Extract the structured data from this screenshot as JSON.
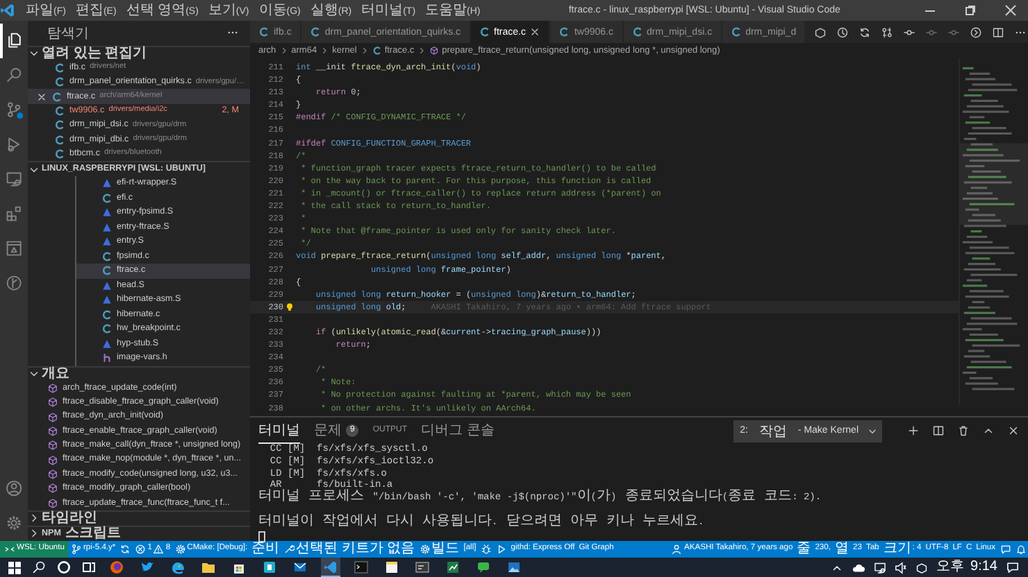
{
  "window": {
    "title": "ftrace.c - linux_raspberrypi [WSL: Ubuntu] - Visual Studio Code",
    "menu": [
      "파일(F)",
      "편집(E)",
      "선택 영역(S)",
      "보기(V)",
      "이동(G)",
      "실행(R)",
      "터미널(T)",
      "도움말(H)"
    ]
  },
  "activity_bar": [
    {
      "kind": "files",
      "selected": true,
      "badge": false
    },
    {
      "kind": "search",
      "selected": false,
      "badge": false
    },
    {
      "kind": "branch",
      "selected": false,
      "badge": true
    },
    {
      "kind": "run",
      "selected": false,
      "badge": false
    },
    {
      "kind": "monitor",
      "selected": false,
      "badge": false
    },
    {
      "kind": "blocks",
      "selected": false,
      "badge": false
    },
    {
      "kind": "panel",
      "selected": false,
      "badge": false
    },
    {
      "kind": "graph",
      "selected": false,
      "badge": false
    },
    {
      "kind": "account",
      "selected": false,
      "badge": false
    },
    {
      "kind": "gear",
      "selected": false,
      "badge": false
    }
  ],
  "sidebar": {
    "title": "탐색기",
    "open_editors": {
      "title": "열려 있는 편집기",
      "expanded": true,
      "items": [
        {
          "name": "ifb.c",
          "path": "drivers/net",
          "kind": "c",
          "selected": false,
          "error": false
        },
        {
          "name": "drm_panel_orientation_quirks.c",
          "path": "drivers/gpu/…",
          "kind": "c",
          "selected": false,
          "error": false
        },
        {
          "name": "ftrace.c",
          "path": "arch/arm64/kernel",
          "kind": "c",
          "selected": true,
          "error": false
        },
        {
          "name": "tw9906.c",
          "path": "drivers/media/i2c",
          "kind": "c",
          "selected": false,
          "error": true,
          "badge": "2, M"
        },
        {
          "name": "drm_mipi_dsi.c",
          "path": "drivers/gpu/drm",
          "kind": "c",
          "selected": false,
          "error": false
        },
        {
          "name": "drm_mipi_dbi.c",
          "path": "drivers/gpu/drm",
          "kind": "c",
          "selected": false,
          "error": false
        },
        {
          "name": "btbcm.c",
          "path": "drivers/bluetooth",
          "kind": "c",
          "selected": false,
          "error": false
        }
      ]
    },
    "folder": {
      "title": "LINUX_RASPBERRYPI [WSL: UBUNTU]",
      "expanded": true,
      "items": [
        {
          "name": "efi-rt-wrapper.S",
          "kind": "asm",
          "selected": false
        },
        {
          "name": "efi.c",
          "kind": "c",
          "selected": false
        },
        {
          "name": "entry-fpsimd.S",
          "kind": "asm",
          "selected": false
        },
        {
          "name": "entry-ftrace.S",
          "kind": "asm",
          "selected": false
        },
        {
          "name": "entry.S",
          "kind": "asm",
          "selected": false
        },
        {
          "name": "fpsimd.c",
          "kind": "c",
          "selected": false
        },
        {
          "name": "ftrace.c",
          "kind": "c",
          "selected": true
        },
        {
          "name": "head.S",
          "kind": "asm",
          "selected": false
        },
        {
          "name": "hibernate-asm.S",
          "kind": "asm",
          "selected": false
        },
        {
          "name": "hibernate.c",
          "kind": "c",
          "selected": false
        },
        {
          "name": "hw_breakpoint.c",
          "kind": "c",
          "selected": false
        },
        {
          "name": "hyp-stub.S",
          "kind": "asm",
          "selected": false
        },
        {
          "name": "image-vars.h",
          "kind": "h",
          "selected": false
        }
      ]
    },
    "outline": {
      "title": "개요",
      "expanded": true,
      "items": [
        "arch_ftrace_update_code(int)",
        "ftrace_disable_ftrace_graph_caller(void)",
        "ftrace_dyn_arch_init(void)",
        "ftrace_enable_ftrace_graph_caller(void)",
        "ftrace_make_call(dyn_ftrace *, unsigned long)",
        "ftrace_make_nop(module *, dyn_ftrace *, un...",
        "ftrace_modify_code(unsigned long, u32, u3...",
        "ftrace_modify_graph_caller(bool)",
        "ftrace_update_ftrace_func(ftrace_func_t f..."
      ]
    },
    "timeline": {
      "title": "타임라인",
      "expanded": false
    },
    "npm": {
      "title": "NPM 스크립트",
      "expanded": false
    }
  },
  "tabs": [
    {
      "label": "ifb.c",
      "selected": false
    },
    {
      "label": "drm_panel_orientation_quirks.c",
      "selected": false
    },
    {
      "label": "ftrace.c",
      "selected": true
    },
    {
      "label": "tw9906.c",
      "selected": false
    },
    {
      "label": "drm_mipi_dsi.c",
      "selected": false
    },
    {
      "label": "drm_mipi_d",
      "selected": false
    }
  ],
  "breadcrumb": [
    {
      "label": "arch",
      "kind": "folder"
    },
    {
      "label": "arm64",
      "kind": "folder"
    },
    {
      "label": "kernel",
      "kind": "folder"
    },
    {
      "label": "ftrace.c",
      "kind": "file"
    },
    {
      "label": "prepare_ftrace_return(unsigned long, unsigned long *, unsigned long)",
      "kind": "symbol"
    }
  ],
  "editor": {
    "lines": [
      {
        "n": "211",
        "current": false,
        "tokens": [
          {
            "kind": "kw",
            "text": "int"
          },
          {
            "kind": "p",
            "text": " __init "
          },
          {
            "kind": "fn",
            "text": "ftrace_dyn_arch_init"
          },
          {
            "kind": "p",
            "text": "("
          },
          {
            "kind": "kw",
            "text": "void"
          },
          {
            "kind": "p",
            "text": ")"
          }
        ]
      },
      {
        "n": "212",
        "current": false,
        "tokens": [
          {
            "kind": "p",
            "text": "{"
          }
        ]
      },
      {
        "n": "213",
        "current": false,
        "tokens": [
          {
            "kind": "ctl",
            "text": "    return"
          },
          {
            "kind": "num",
            "text": " 0"
          },
          {
            "kind": "p",
            "text": ";"
          }
        ]
      },
      {
        "n": "214",
        "current": false,
        "tokens": [
          {
            "kind": "p",
            "text": "}"
          }
        ]
      },
      {
        "n": "215",
        "current": false,
        "tokens": [
          {
            "kind": "pp",
            "text": "#endif"
          },
          {
            "kind": "cm",
            "text": " /* CONFIG_DYNAMIC_FTRACE */"
          }
        ]
      },
      {
        "n": "216",
        "current": false
      },
      {
        "n": "217",
        "current": false,
        "tokens": [
          {
            "kind": "pp",
            "text": "#ifdef"
          },
          {
            "kind": "mac",
            "text": " CONFIG_FUNCTION_GRAPH_TRACER"
          }
        ]
      },
      {
        "n": "218",
        "current": false,
        "tokens": [
          {
            "kind": "cm",
            "text": "/*"
          }
        ]
      },
      {
        "n": "219",
        "current": false,
        "tokens": [
          {
            "kind": "cm",
            "text": " * function_graph tracer expects ftrace_return_to_handler() to be called"
          }
        ]
      },
      {
        "n": "220",
        "current": false,
        "tokens": [
          {
            "kind": "cm",
            "text": " * on the way back to parent. For this purpose, this function is called"
          }
        ]
      },
      {
        "n": "221",
        "current": false,
        "tokens": [
          {
            "kind": "cm",
            "text": " * in _mcount() or ftrace_caller() to replace return address (*parent) on"
          }
        ]
      },
      {
        "n": "222",
        "current": false,
        "tokens": [
          {
            "kind": "cm",
            "text": " * the call stack to return_to_handler."
          }
        ]
      },
      {
        "n": "223",
        "current": false,
        "tokens": [
          {
            "kind": "cm",
            "text": " *"
          }
        ]
      },
      {
        "n": "224",
        "current": false,
        "tokens": [
          {
            "kind": "cm",
            "text": " * Note that @frame_pointer is used only for sanity check later."
          }
        ]
      },
      {
        "n": "225",
        "current": false,
        "tokens": [
          {
            "kind": "cm",
            "text": " */"
          }
        ]
      },
      {
        "n": "226",
        "current": false,
        "tokens": [
          {
            "kind": "kw",
            "text": "void"
          },
          {
            "kind": "fn",
            "text": " prepare_ftrace_return"
          },
          {
            "kind": "p",
            "text": "("
          },
          {
            "kind": "kw",
            "text": "unsigned long"
          },
          {
            "kind": "var",
            "text": " self_addr"
          },
          {
            "kind": "p",
            "text": ", "
          },
          {
            "kind": "kw",
            "text": "unsigned long"
          },
          {
            "kind": "p",
            "text": " *"
          },
          {
            "kind": "var",
            "text": "parent"
          },
          {
            "kind": "p",
            "text": ","
          }
        ]
      },
      {
        "n": "227",
        "current": false,
        "tokens": [
          {
            "kind": "kw",
            "text": "               unsigned long"
          },
          {
            "kind": "var",
            "text": " frame_pointer"
          },
          {
            "kind": "p",
            "text": ")"
          }
        ]
      },
      {
        "n": "228",
        "current": false,
        "tokens": [
          {
            "kind": "p",
            "text": "{"
          }
        ]
      },
      {
        "n": "229",
        "current": false,
        "tokens": [
          {
            "kind": "kw",
            "text": "    unsigned long"
          },
          {
            "kind": "var",
            "text": " return_hooker"
          },
          {
            "kind": "p",
            "text": " = ("
          },
          {
            "kind": "kw",
            "text": "unsigned long"
          },
          {
            "kind": "p",
            "text": ")&"
          },
          {
            "kind": "var",
            "text": "return_to_handler"
          },
          {
            "kind": "p",
            "text": ";"
          }
        ]
      },
      {
        "n": "230",
        "current": true,
        "lightbulb": true,
        "blame": "AKASHI Takahiro, 7 years ago • arm64: Add ftrace support",
        "tokens": [
          {
            "kind": "kw",
            "text": "    unsigned long"
          },
          {
            "kind": "var",
            "text": " old"
          },
          {
            "kind": "p",
            "text": ";"
          }
        ]
      },
      {
        "n": "231",
        "current": false
      },
      {
        "n": "232",
        "current": false,
        "tokens": [
          {
            "kind": "ctl",
            "text": "    if"
          },
          {
            "kind": "p",
            "text": " ("
          },
          {
            "kind": "fn",
            "text": "unlikely"
          },
          {
            "kind": "p",
            "text": "("
          },
          {
            "kind": "fn",
            "text": "atomic_read"
          },
          {
            "kind": "p",
            "text": "(&"
          },
          {
            "kind": "var",
            "text": "current"
          },
          {
            "kind": "p",
            "text": "->"
          },
          {
            "kind": "var",
            "text": "tracing_graph_pause"
          },
          {
            "kind": "p",
            "text": ")))"
          }
        ]
      },
      {
        "n": "233",
        "current": false,
        "tokens": [
          {
            "kind": "ctl",
            "text": "        return"
          },
          {
            "kind": "p",
            "text": ";"
          }
        ]
      },
      {
        "n": "234",
        "current": false
      },
      {
        "n": "235",
        "current": false,
        "tokens": [
          {
            "kind": "cm",
            "text": "    /*"
          }
        ]
      },
      {
        "n": "236",
        "current": false,
        "tokens": [
          {
            "kind": "cm",
            "text": "     * Note:"
          }
        ]
      },
      {
        "n": "237",
        "current": false,
        "tokens": [
          {
            "kind": "cm",
            "text": "     * No protection against faulting at *parent, which may be seen"
          }
        ]
      },
      {
        "n": "238",
        "current": false,
        "tokens": [
          {
            "kind": "cm",
            "text": "     * on other archs. It's unlikely on AArch64."
          }
        ]
      }
    ]
  },
  "panel": {
    "tabs": [
      {
        "label": "터미널",
        "selected": true
      },
      {
        "label": "문제",
        "selected": false,
        "badge": "9"
      },
      {
        "label": "OUTPUT",
        "selected": false
      },
      {
        "label": "디버그 콘솔",
        "selected": false
      }
    ],
    "terminal_select": "2: 작업 - Make Kernel",
    "lines": [
      {
        "text": "  CC [M]  fs/xfs/xfs_sysctl.o"
      },
      {
        "text": "  CC [M]  fs/xfs/xfs_ioctl32.o"
      },
      {
        "text": "  LD [M]  fs/xfs/xfs.o"
      },
      {
        "text": "  AR      fs/built-in.a"
      },
      {
        "text": "터미널 프로세스 \"/bin/bash '-c', 'make -j$(nproc)'\"이(가) 종료되었습니다(종료 코드: 2)."
      },
      {
        "blank": true
      },
      {
        "text": "터미널이 작업에서 다시 사용됩니다. 닫으려면 아무 키나 누르세요."
      }
    ]
  },
  "status_bar": {
    "left": [
      {
        "kind": "remote",
        "text": "WSL: Ubuntu"
      },
      {
        "kind": "branch",
        "text": "rpi-5.4.y*"
      },
      {
        "kind": "sync"
      },
      {
        "kind": "problems",
        "errors": "1",
        "warnings": "8"
      },
      {
        "kind": "cmake",
        "text": "CMake: [Debug]: 준비"
      },
      {
        "kind": "kit",
        "text": "선택된 키트가 없음"
      },
      {
        "kind": "build",
        "text": "빌드"
      },
      {
        "kind": "plain",
        "text": "[all]"
      },
      {
        "kind": "bug"
      },
      {
        "kind": "play"
      },
      {
        "kind": "plain",
        "text": "githd: Express Off"
      },
      {
        "kind": "plain",
        "text": "Git Graph"
      }
    ],
    "right": [
      {
        "kind": "person",
        "text": "AKASHI Takahiro, 7 years ago"
      },
      {
        "kind": "plain",
        "text": "줄 230, 열 23"
      },
      {
        "kind": "plain",
        "text": "Tab 크기: 4"
      },
      {
        "kind": "plain",
        "text": "UTF-8"
      },
      {
        "kind": "plain",
        "text": "LF"
      },
      {
        "kind": "plain",
        "text": "C"
      },
      {
        "kind": "plain",
        "text": "Linux"
      },
      {
        "kind": "feedback"
      },
      {
        "kind": "bell"
      }
    ]
  },
  "taskbar": {
    "apps": [
      {
        "kind": "browser",
        "active": false
      },
      {
        "kind": "bird",
        "active": false
      },
      {
        "kind": "globe",
        "active": false
      },
      {
        "kind": "folder",
        "active": false
      },
      {
        "kind": "bag",
        "active": false
      },
      {
        "kind": "tile",
        "active": false
      },
      {
        "kind": "mail",
        "active": false
      },
      {
        "kind": "code",
        "active": true
      },
      {
        "kind": "terminal",
        "active": false
      },
      {
        "kind": "notes",
        "active": false
      },
      {
        "kind": "console",
        "active": false
      },
      {
        "kind": "chart",
        "active": false
      },
      {
        "kind": "chat",
        "active": false
      },
      {
        "kind": "photo",
        "active": false
      }
    ],
    "time": "오후 9:14"
  }
}
